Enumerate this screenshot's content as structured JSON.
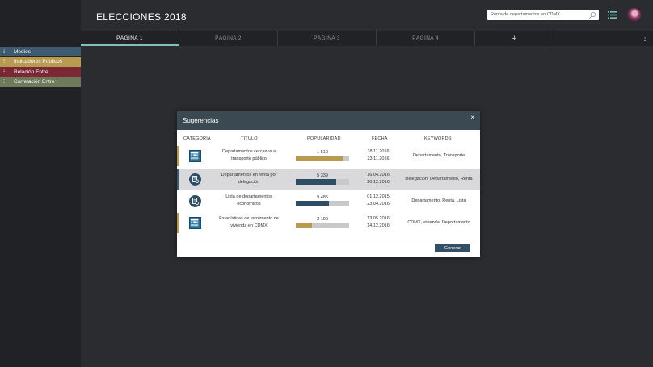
{
  "app": {
    "title": "ELECCIONES 2018"
  },
  "search": {
    "value": "Renta de departamentos en CDMX"
  },
  "tabs": [
    {
      "label": "PÁGINA 1",
      "active": true
    },
    {
      "label": "PÁGINA 2"
    },
    {
      "label": "PÁGINA 3"
    },
    {
      "label": "PÁGINA 4"
    }
  ],
  "add_tab_label": "+",
  "more_icon": "⋮",
  "sidebar": {
    "items": [
      {
        "label": "Medios",
        "color": "#3e5a70"
      },
      {
        "label": "Indicadores Públicos",
        "color": "#b89b4e"
      },
      {
        "label": "Relación Entre",
        "color": "#7a2736"
      },
      {
        "label": "Correlación Entre",
        "color": "#6e7a5a"
      }
    ]
  },
  "modal": {
    "title": "Sugerencias",
    "close": "×",
    "columns": [
      "CATEGORÍA",
      "TÍTULO",
      "POPULARIDAD",
      "FECHA",
      "KEYWORDS"
    ],
    "rows": [
      {
        "icon": "inegi-logo-icon",
        "title": "Departamentos cercanos a transporte público",
        "pop_label": "1 510",
        "pop_pct": 0.88,
        "pop_color": "#b89b4e",
        "date1": "18.11.2016",
        "date2": "23.11.2016",
        "keywords": "Departamento, Transporte",
        "stripe": "#b89b4e",
        "highlight": false
      },
      {
        "icon": "document-circle-icon",
        "title": "Departamentos en renta por delegación",
        "pop_label": "5 339",
        "pop_pct": 0.75,
        "pop_color": "#2e4d65",
        "date1": "16.04.2016",
        "date2": "20.12.2016",
        "keywords": "Delegación, Departamento, Renta",
        "stripe": "#3e5a70",
        "highlight": true
      },
      {
        "icon": "document-circle-icon",
        "title": "Lista de departamentos económicos",
        "pop_label": "9 485",
        "pop_pct": 0.62,
        "pop_color": "#2e4d65",
        "date1": "01.12.2015",
        "date2": "23.04.2016",
        "keywords": "Departamento, Renta, Lista",
        "stripe": null,
        "highlight": false
      },
      {
        "icon": "inegi-logo-icon",
        "title": "Estadísticas de incremento de vivienda en CDMX",
        "pop_label": "2 190",
        "pop_pct": 0.3,
        "pop_color": "#b89b4e",
        "date1": "13.05.2016",
        "date2": "14.12.2016",
        "keywords": "CDMX, vivienda, Departamento",
        "stripe": "#b89b4e",
        "highlight": false
      }
    ],
    "generate_label": "Generar"
  }
}
